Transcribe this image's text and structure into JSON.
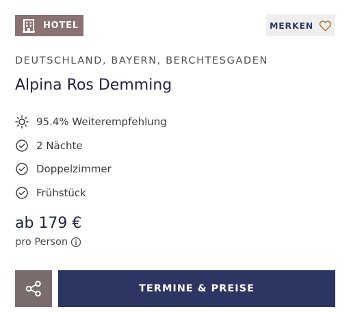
{
  "badge": {
    "label": "HOTEL",
    "icon": "hotel-building-icon",
    "color": "#8a7272"
  },
  "merken": {
    "label": "MERKEN",
    "icon": "heart-outline-icon",
    "icon_color": "#b07a2e"
  },
  "location": "DEUTSCHLAND, BAYERN, BERCHTESGADEN",
  "title": "Alpina Ros Demming",
  "features": [
    {
      "icon": "sun-icon",
      "text": "95.4% Weiterempfehlung"
    },
    {
      "icon": "check-circle-icon",
      "text": "2 Nächte"
    },
    {
      "icon": "check-circle-icon",
      "text": "Doppelzimmer"
    },
    {
      "icon": "check-circle-icon",
      "text": "Frühstück"
    }
  ],
  "price": {
    "text": "ab 179 €",
    "note": "pro Person",
    "note_icon": "info-icon"
  },
  "actions": {
    "share_icon": "share-icon",
    "cta_label": "TERMINE & PREISE",
    "cta_color": "#2d3563",
    "share_color": "#7a6b6c"
  }
}
